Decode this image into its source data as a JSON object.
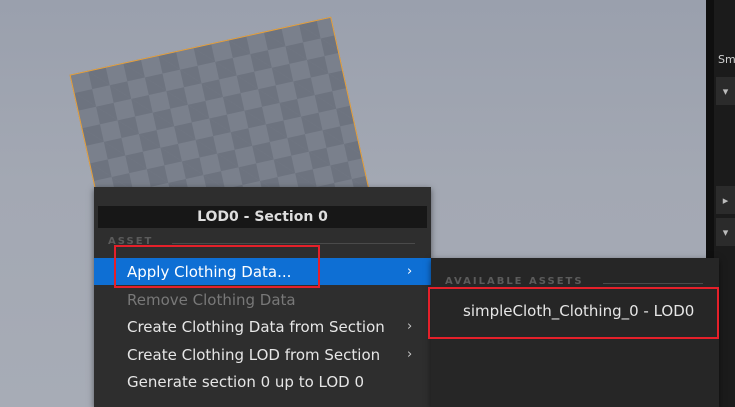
{
  "context_menu": {
    "title": "LOD0 - Section 0",
    "section_header": "ASSET",
    "items": [
      {
        "label": "Apply Clothing Data...",
        "has_submenu": true,
        "state": "highlighted"
      },
      {
        "label": "Remove Clothing Data",
        "has_submenu": false,
        "state": "disabled"
      },
      {
        "label": "Create Clothing Data from Section",
        "has_submenu": true,
        "state": "normal"
      },
      {
        "label": "Create Clothing LOD from Section",
        "has_submenu": true,
        "state": "normal"
      },
      {
        "label": "Generate section 0 up to LOD 0",
        "has_submenu": false,
        "state": "normal"
      }
    ],
    "submenu_arrow": "›"
  },
  "submenu": {
    "section_header": "AVAILABLE ASSETS",
    "items": [
      {
        "label": "simpleCloth_Clothing_0 - LOD0"
      }
    ]
  },
  "side_panel": {
    "label": "Sm",
    "buttons": [
      "▾",
      "▸",
      "▾"
    ]
  },
  "colors": {
    "highlight": "#0e6fd4",
    "selection_outline": "#e7a03a",
    "annotation": "#e5202a",
    "menu_bg": "#2e2e2e"
  }
}
